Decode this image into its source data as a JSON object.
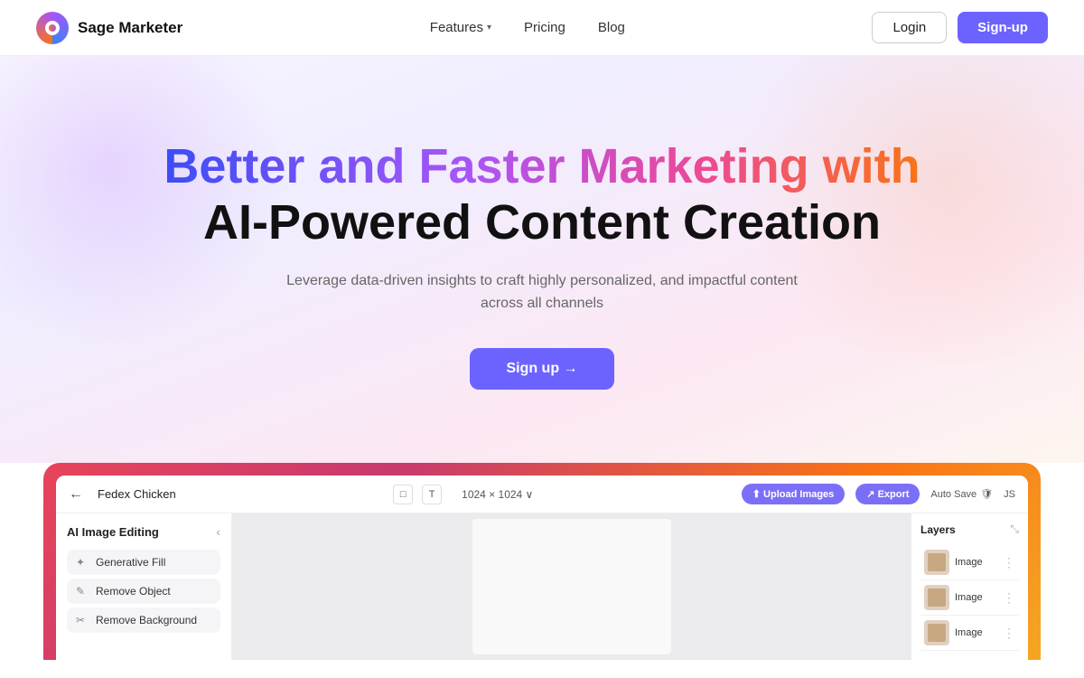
{
  "nav": {
    "logo_alt": "Sage Marketer logo",
    "brand": "Sage Marketer",
    "links": [
      {
        "id": "features",
        "label": "Features",
        "has_dropdown": true
      },
      {
        "id": "pricing",
        "label": "Pricing",
        "has_dropdown": false
      },
      {
        "id": "blog",
        "label": "Blog",
        "has_dropdown": false
      }
    ],
    "login_label": "Login",
    "signup_label": "Sign-up"
  },
  "hero": {
    "title_line1": "Better and Faster Marketing with",
    "title_line2": "AI-Powered Content Creation",
    "subtitle": "Leverage data-driven insights to craft highly personalized, and impactful content across all channels",
    "cta_label": "Sign up →"
  },
  "app_preview": {
    "toolbar": {
      "back_icon": "←",
      "project_name": "Fedex Chicken",
      "canvas_icon": "□",
      "text_icon": "T",
      "canvas_size": "1024 × 1024 ∨",
      "upload_label": "⬆ Upload Images",
      "export_label": "↗ Export",
      "autosave_label": "Auto Save",
      "js_label": "JS"
    },
    "sidebar": {
      "title": "AI Image Editing",
      "collapse_icon": "‹",
      "items": [
        {
          "icon": "✦",
          "label": "Generative Fill"
        },
        {
          "icon": "✎",
          "label": "Remove Object"
        },
        {
          "icon": "✂",
          "label": "Remove Background"
        }
      ]
    },
    "layers": {
      "title": "Layers",
      "collapse_icon": "⤡",
      "items": [
        {
          "label": "Image"
        },
        {
          "label": "Image"
        },
        {
          "label": "Image"
        }
      ]
    }
  }
}
